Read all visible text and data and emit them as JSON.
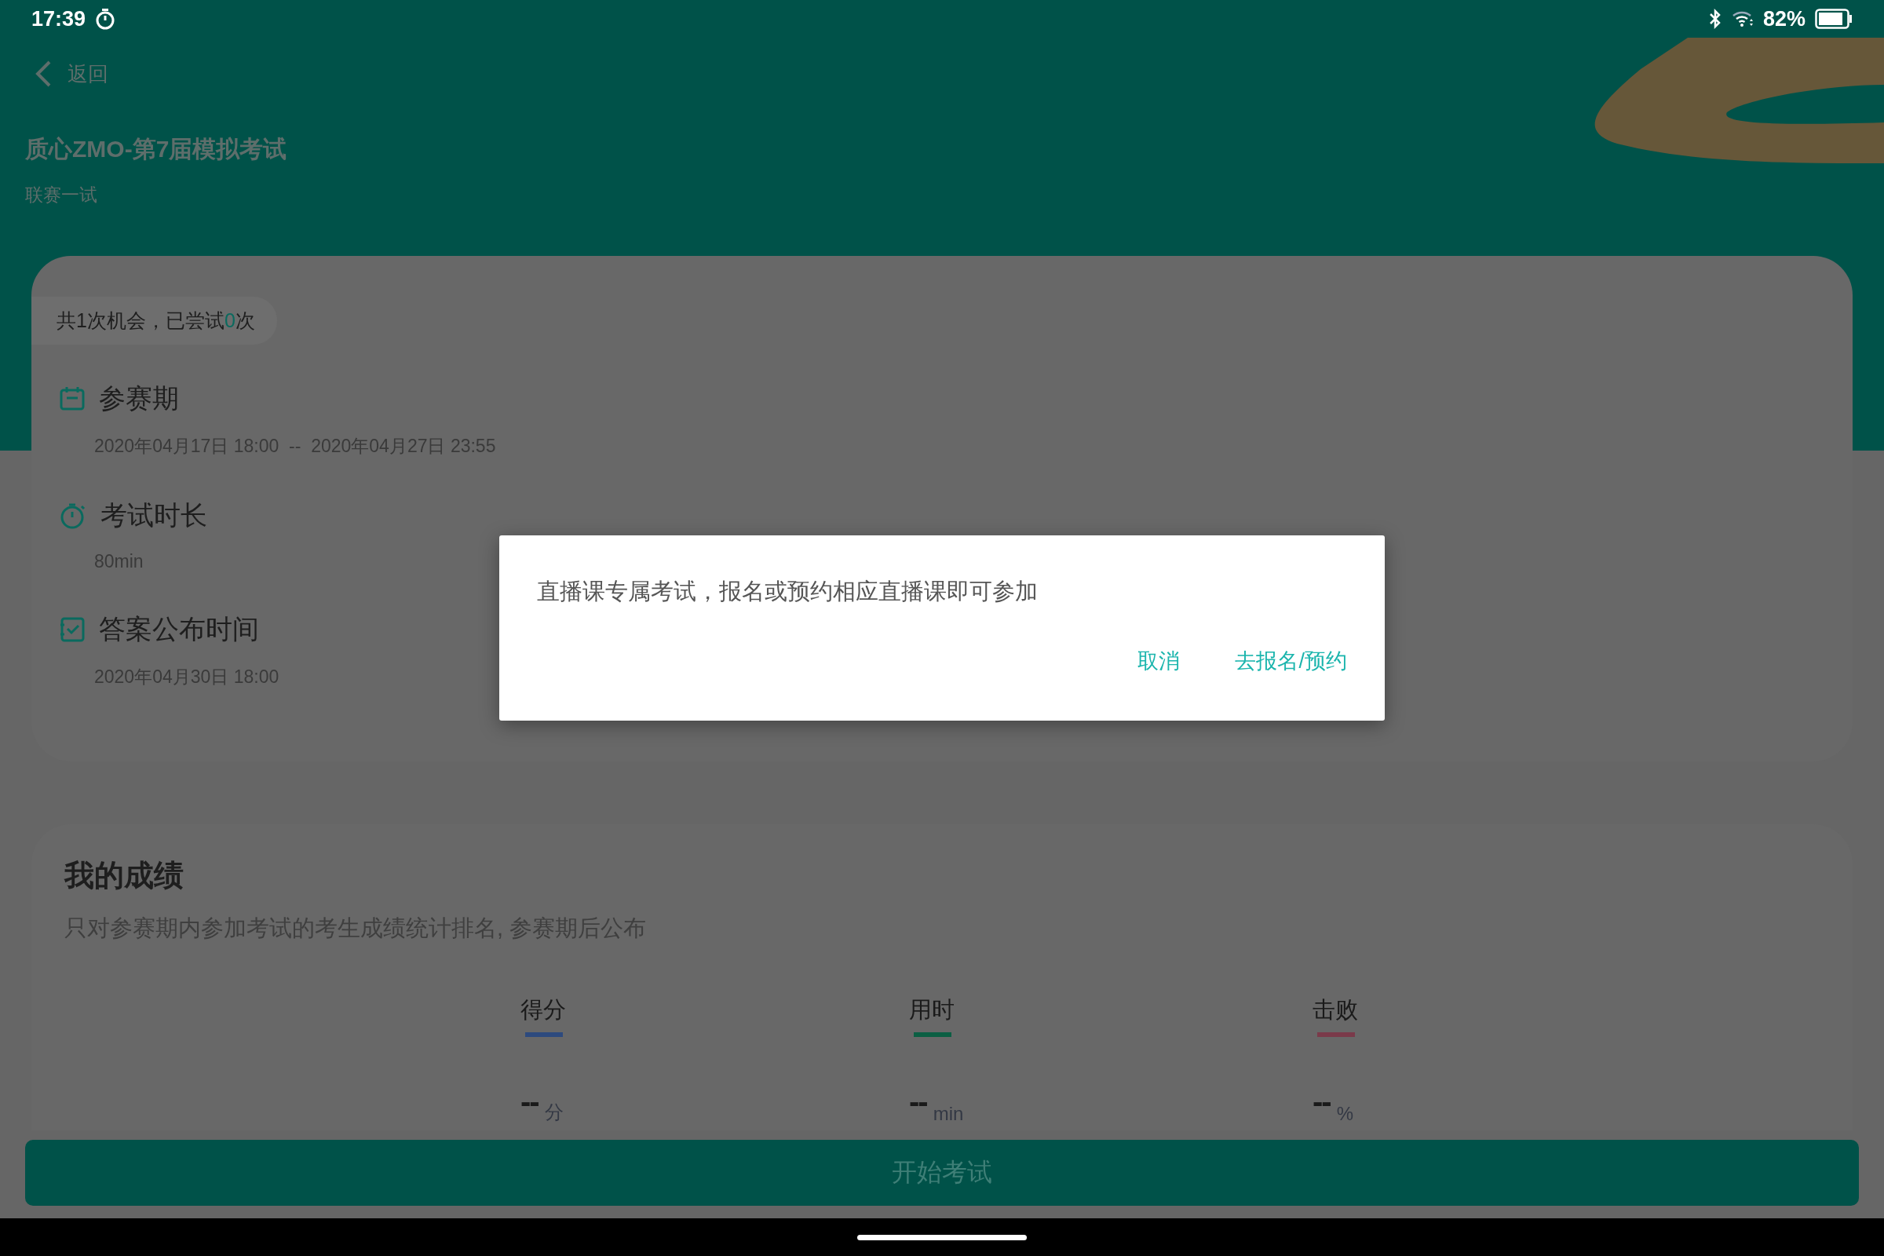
{
  "status_bar": {
    "time": "17:39",
    "battery": "82%"
  },
  "header": {
    "back_label": "返回",
    "title": "质心ZMO-第7届模拟考试",
    "subtitle": "联赛一试"
  },
  "attempts": {
    "prefix": "共1次机会，已尝试",
    "count": "0",
    "suffix": "次"
  },
  "info_sections": [
    {
      "kind": "calendar",
      "heading": "参赛期",
      "value": "2020年04月17日 18:00  --  2020年04月27日 23:55"
    },
    {
      "kind": "timer",
      "heading": "考试时长",
      "value": "80min"
    },
    {
      "kind": "check",
      "heading": "答案公布时间",
      "value": "2020年04月30日 18:00"
    }
  ],
  "results": {
    "title": "我的成绩",
    "note": "只对参赛期内参加考试的考生成绩统计排名, 参赛期后公布",
    "metrics": [
      {
        "label": "得分",
        "value": "--",
        "unit": "分",
        "color": "#2d4a7e"
      },
      {
        "label": "用时",
        "value": "--",
        "unit": "min",
        "color": "#0b5f43"
      },
      {
        "label": "击败",
        "value": "--",
        "unit": "%",
        "color": "#7a3a4a"
      }
    ]
  },
  "start_button": "开始考试",
  "dialog": {
    "message": "直播课专属考试，报名或预约相应直播课即可参加",
    "buttons": [
      "取消",
      "去报名/预约"
    ]
  }
}
